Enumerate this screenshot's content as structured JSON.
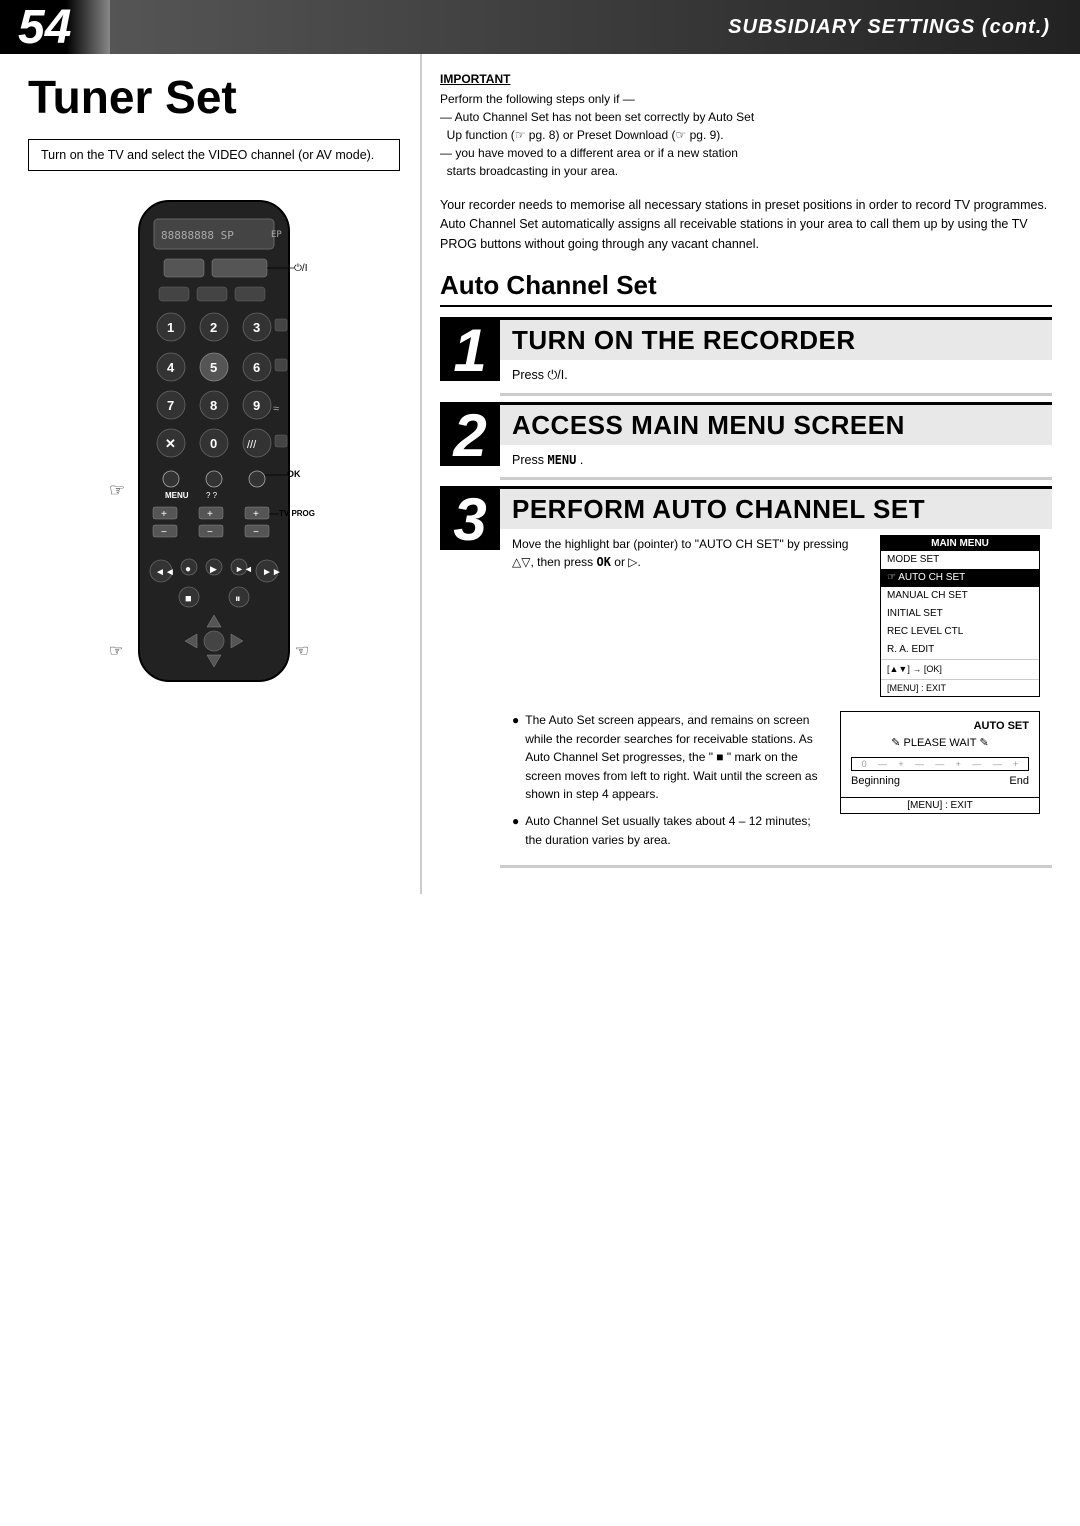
{
  "header": {
    "page_number": "54",
    "title": "SUBSIDIARY SETTINGS (cont.)"
  },
  "left": {
    "section_title": "Tuner Set",
    "intro_text": "Turn on the TV and select the VIDEO channel (or AV mode)."
  },
  "right": {
    "important_label": "IMPORTANT",
    "important_lines": [
      "Perform the following steps only if —",
      "— Auto Channel Set has not been set correctly by Auto Set",
      "  Up function (☞ pg. 8) or Preset Download (☞ pg. 9).",
      "— you have moved to a different area or if a new station",
      "  starts broadcasting in your area."
    ],
    "body_text": "Your recorder needs to memorise all necessary stations in preset positions in order to record TV programmes. Auto Channel Set automatically assigns all receivable stations in your area to call them up by using the TV PROG buttons without going through any vacant channel.",
    "auto_channel_heading": "Auto Channel Set",
    "steps": [
      {
        "number": "1",
        "title": "TURN ON THE RECORDER",
        "instruction": "Press ⏻/I."
      },
      {
        "number": "2",
        "title": "ACCESS MAIN MENU SCREEN",
        "instruction": "Press MENU ."
      },
      {
        "number": "3",
        "title": "PERFORM AUTO CHANNEL SET",
        "instruction": "Move the highlight bar (pointer) to \"AUTO CH SET\" by pressing △▽, then press OK or ▷."
      }
    ],
    "menu_screen": {
      "title": "MAIN MENU",
      "rows": [
        "MODE SET",
        "AUTO CH SET",
        "MANUAL CH SET",
        "INITIAL SET",
        "REC LEVEL CTL",
        "R. A. EDIT"
      ],
      "highlighted_row": "AUTO CH SET",
      "arrow_text": "[▲▼] → [OK]",
      "exit_text": "[MENU] : EXIT"
    },
    "bullet1_text": "The Auto Set screen appears, and remains on screen while the recorder searches for receivable stations. As Auto Channel Set progresses, the \" ■ \" mark on the screen moves from left to right. Wait until the screen as shown in step 4 appears.",
    "bullet2_text": "Auto Channel Set usually takes about 4 – 12 minutes; the duration varies by area.",
    "auto_set_screen": {
      "title": "AUTO SET",
      "please_wait": "PLEASE WAIT",
      "exit_text": "[MENU] : EXIT",
      "beginning_label": "Beginning",
      "end_label": "End"
    }
  }
}
